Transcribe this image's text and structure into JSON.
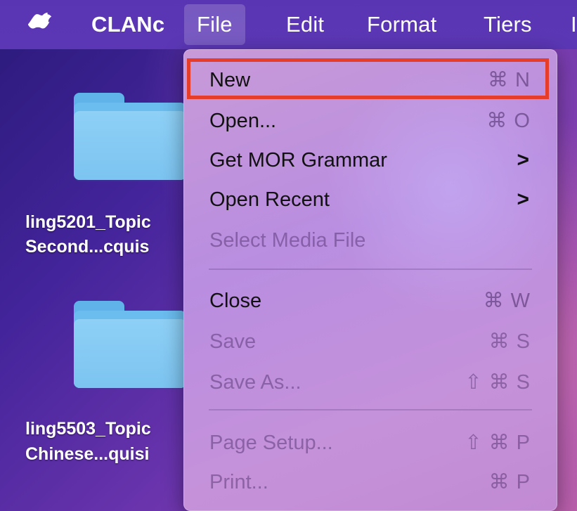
{
  "menubar": {
    "apple_icon": "apple-logo-icon",
    "app_name": "CLANc",
    "items": [
      "File",
      "Edit",
      "Format",
      "Tiers"
    ],
    "active_item": "File",
    "overflow_glyph": "I"
  },
  "desktop": {
    "folders": [
      {
        "line1": "ling5201_Topic",
        "line2": "Second...cquis"
      },
      {
        "line1": "ling5503_Topic",
        "line2": "Chinese...quisi"
      }
    ],
    "folder_icon": "folder-icon"
  },
  "file_menu": {
    "items": [
      {
        "label": "New",
        "shortcut": "⌘ N",
        "enabled": true,
        "highlighted": true
      },
      {
        "label": "Open...",
        "shortcut": "⌘ O",
        "enabled": true
      },
      {
        "label": "Get MOR Grammar",
        "submenu": ">",
        "enabled": true
      },
      {
        "label": "Open Recent",
        "submenu": ">",
        "enabled": true
      },
      {
        "label": "Select Media File",
        "enabled": false
      },
      {
        "label": "Close",
        "shortcut": "⌘ W",
        "enabled": true
      },
      {
        "label": "Save",
        "shortcut": "⌘ S",
        "enabled": false
      },
      {
        "label": "Save As...",
        "shortcut": "⇧ ⌘ S",
        "enabled": false
      },
      {
        "label": "Page Setup...",
        "shortcut": "⇧ ⌘ P",
        "enabled": false
      },
      {
        "label": "Print...",
        "shortcut": "⌘ P",
        "enabled": false
      }
    ]
  },
  "colors": {
    "highlight_box": "#e63c2a",
    "menubar": "#5a35b3",
    "folder": "#7cc4f1"
  }
}
